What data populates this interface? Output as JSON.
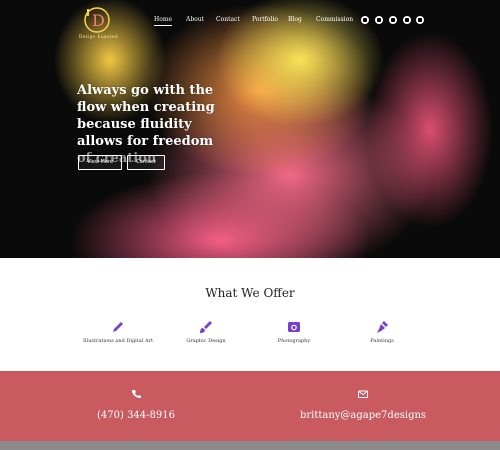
{
  "brand": {
    "logo_letter": "D",
    "logo_text": "Design Exposed"
  },
  "nav": {
    "items": [
      {
        "label": "Home",
        "active": true
      },
      {
        "label": "About",
        "active": false
      },
      {
        "label": "Contact",
        "active": false
      },
      {
        "label": "Portfolio",
        "active": false
      },
      {
        "label": "Blog",
        "active": false
      },
      {
        "label": "Commission",
        "active": false
      }
    ]
  },
  "social": [
    "instagram-icon",
    "youtube-icon",
    "twitter-icon",
    "pinterest-icon",
    "pinterest-alt-icon"
  ],
  "hero": {
    "headline_main": "Always go with the flow when creating because fluidity allows for freedom",
    "headline_faded": "of creation",
    "btn_view_more": "View More",
    "btn_contact": "Contact"
  },
  "offer": {
    "title": "What We Offer",
    "items": [
      {
        "label": "Illustrations and Digital Art",
        "icon": "pencil-icon"
      },
      {
        "label": "Graphic Design",
        "icon": "brush-icon"
      },
      {
        "label": "Photography",
        "icon": "photo-icon"
      },
      {
        "label": "Paintings",
        "icon": "pen-nib-icon"
      }
    ]
  },
  "contact": {
    "phone": "(470) 344-8916",
    "email": "brittany@agape7designs"
  },
  "colors": {
    "accent": "#7b3fd0",
    "contact_bg": "#c85a60",
    "hero_bg": "#0a0a0a"
  }
}
